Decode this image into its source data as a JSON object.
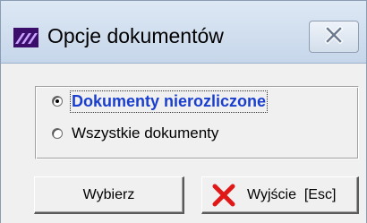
{
  "window": {
    "title": "Opcje dokumentów"
  },
  "options": [
    {
      "label": "Dokumenty nierozliczone",
      "checked": true
    },
    {
      "label": "Wszystkie dokumenty",
      "checked": false
    }
  ],
  "buttons": {
    "select_label": "Wybierz",
    "exit_label": "Wyjście  [Esc]"
  },
  "icons": {
    "app": "app-logo-icon",
    "close": "close-icon",
    "exit": "red-x-icon"
  },
  "colors": {
    "selected_text": "#1a3fcf",
    "exit_icon": "#e01818",
    "app_icon": "#6a1fb5"
  }
}
